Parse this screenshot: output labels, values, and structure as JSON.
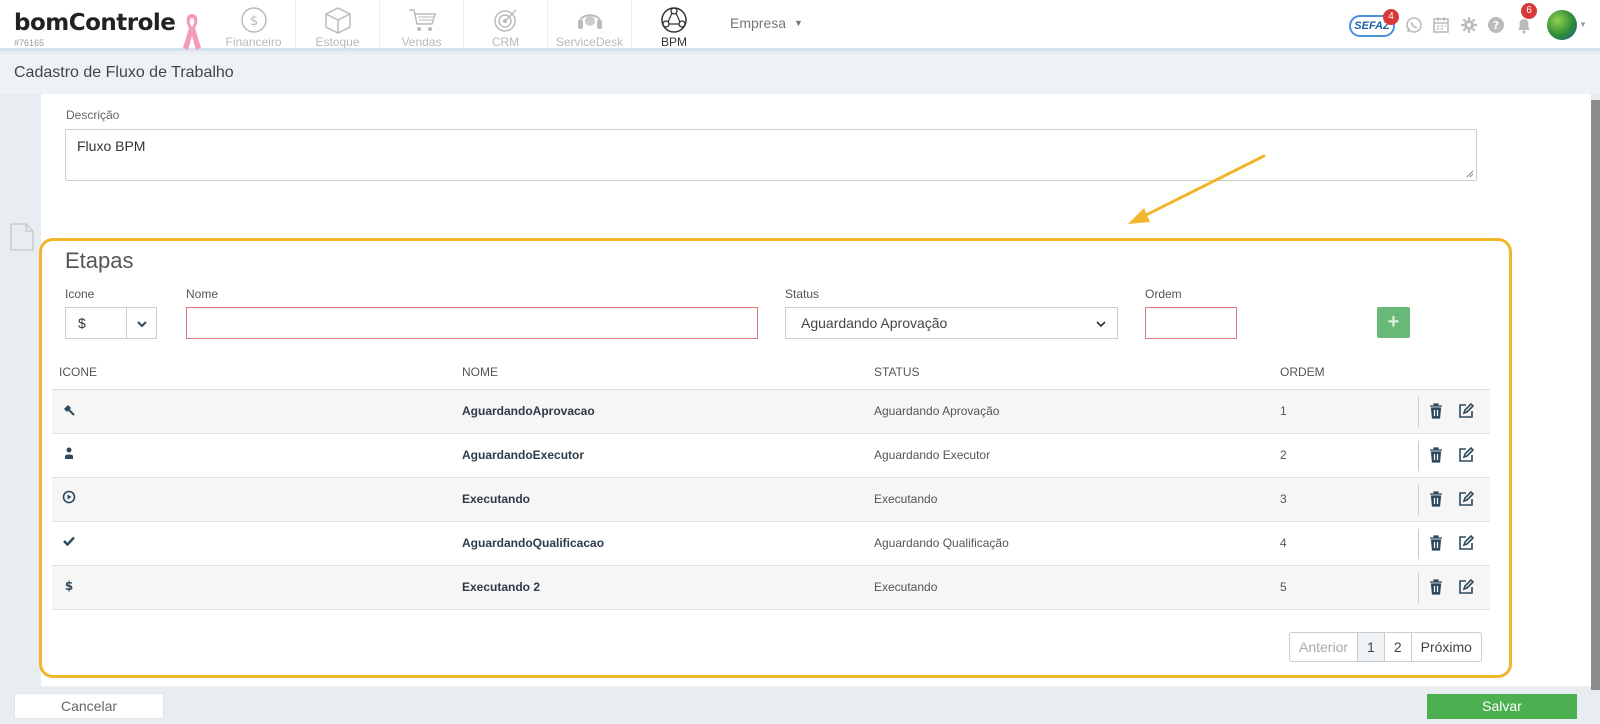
{
  "header": {
    "logo": "bomControle",
    "account_id": "#76165",
    "modules": [
      {
        "label": "Financeiro",
        "icon": "dollar-circle-icon"
      },
      {
        "label": "Estoque",
        "icon": "box-icon"
      },
      {
        "label": "Vendas",
        "icon": "cart-icon"
      },
      {
        "label": "CRM",
        "icon": "target-icon"
      },
      {
        "label": "ServiceDesk",
        "icon": "headset-icon"
      },
      {
        "label": "BPM",
        "icon": "network-icon"
      }
    ],
    "active_module": "BPM",
    "empresa_label": "Empresa",
    "sefaz_label": "SEFAZ",
    "sefaz_badge": "4",
    "notifications_badge": "6"
  },
  "page": {
    "title": "Cadastro de Fluxo de Trabalho"
  },
  "form": {
    "description_label": "Descrição",
    "description_value": "Fluxo BPM"
  },
  "etapas": {
    "title": "Etapas",
    "fields": {
      "icon_label": "Icone",
      "icon_value": "$",
      "name_label": "Nome",
      "name_value": "",
      "status_label": "Status",
      "status_value": "Aguardando Aprovação",
      "order_label": "Ordem",
      "order_value": "",
      "add_label": "+"
    },
    "columns": [
      "ICONE",
      "NOME",
      "STATUS",
      "ORDEM"
    ],
    "rows": [
      {
        "icon": "gavel-icon",
        "name": "AguardandoAprovacao",
        "status": "Aguardando Aprovação",
        "order": "1"
      },
      {
        "icon": "user-icon",
        "name": "AguardandoExecutor",
        "status": "Aguardando Executor",
        "order": "2"
      },
      {
        "icon": "play-circle-icon",
        "name": "Executando",
        "status": "Executando",
        "order": "3"
      },
      {
        "icon": "check-icon",
        "name": "AguardandoQualificacao",
        "status": "Aguardando Qualificação",
        "order": "4"
      },
      {
        "icon": "dollar-icon",
        "name": "Executando 2",
        "status": "Executando",
        "order": "5"
      }
    ],
    "pagination": {
      "prev": "Anterior",
      "pages": [
        "1",
        "2"
      ],
      "current": "1",
      "next": "Próximo"
    }
  },
  "footer": {
    "cancel_label": "Cancelar",
    "save_label": "Salvar"
  },
  "colors": {
    "highlight_border": "#f0b62c",
    "save_green": "#4caf50",
    "add_green": "#68b878",
    "required_red": "#e07a7a",
    "badge_red": "#d9383a"
  }
}
